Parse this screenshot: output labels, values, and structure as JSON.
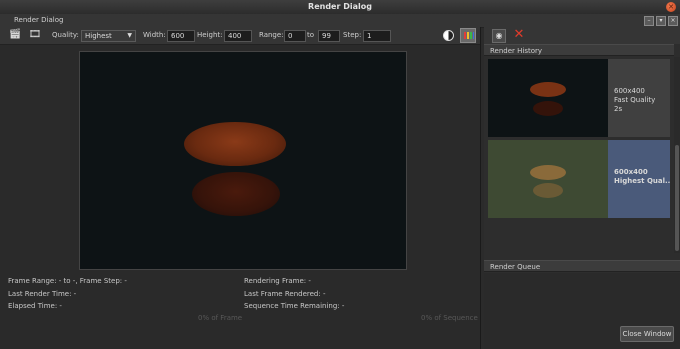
{
  "window": {
    "title": "Render Dialog"
  },
  "dock": {
    "title": "Render Dialog"
  },
  "toolbar": {
    "quality_label": "Quality:",
    "quality_value": "Highest",
    "width_label": "Width:",
    "width_value": "600",
    "height_label": "Height:",
    "height_value": "400",
    "range_label": "Range:",
    "range_start": "0",
    "range_to": "to",
    "range_end": "99",
    "step_label": "Step:",
    "step_value": "1"
  },
  "info": {
    "frame_range": "Frame Range: - to -, Frame Step: -",
    "last_render_time": "Last Render Time: -",
    "elapsed_time": "Elapsed Time: -",
    "rendering_frame": "Rendering Frame: -",
    "last_frame_rendered": "Last Frame Rendered: -",
    "sequence_time_remaining": "Sequence Time Remaining: -",
    "frame_progress": "0% of Frame",
    "sequence_progress": "0% of Sequence"
  },
  "history": {
    "header": "Render History",
    "items": [
      {
        "size": "600x400",
        "quality": "Fast Quality",
        "time": "2s"
      },
      {
        "size": "600x400",
        "quality": "Highest Qual..."
      }
    ]
  },
  "queue": {
    "header": "Render Queue"
  },
  "footer": {
    "close_label": "Close Window"
  },
  "icons": [
    "clapboard-icon",
    "clapboard-multi-icon",
    "contrast-icon",
    "color-channels-icon",
    "camera-icon",
    "delete-icon"
  ],
  "colors": {
    "selected_history": "#4a5a7a",
    "delete_red": "#e03b2b"
  }
}
